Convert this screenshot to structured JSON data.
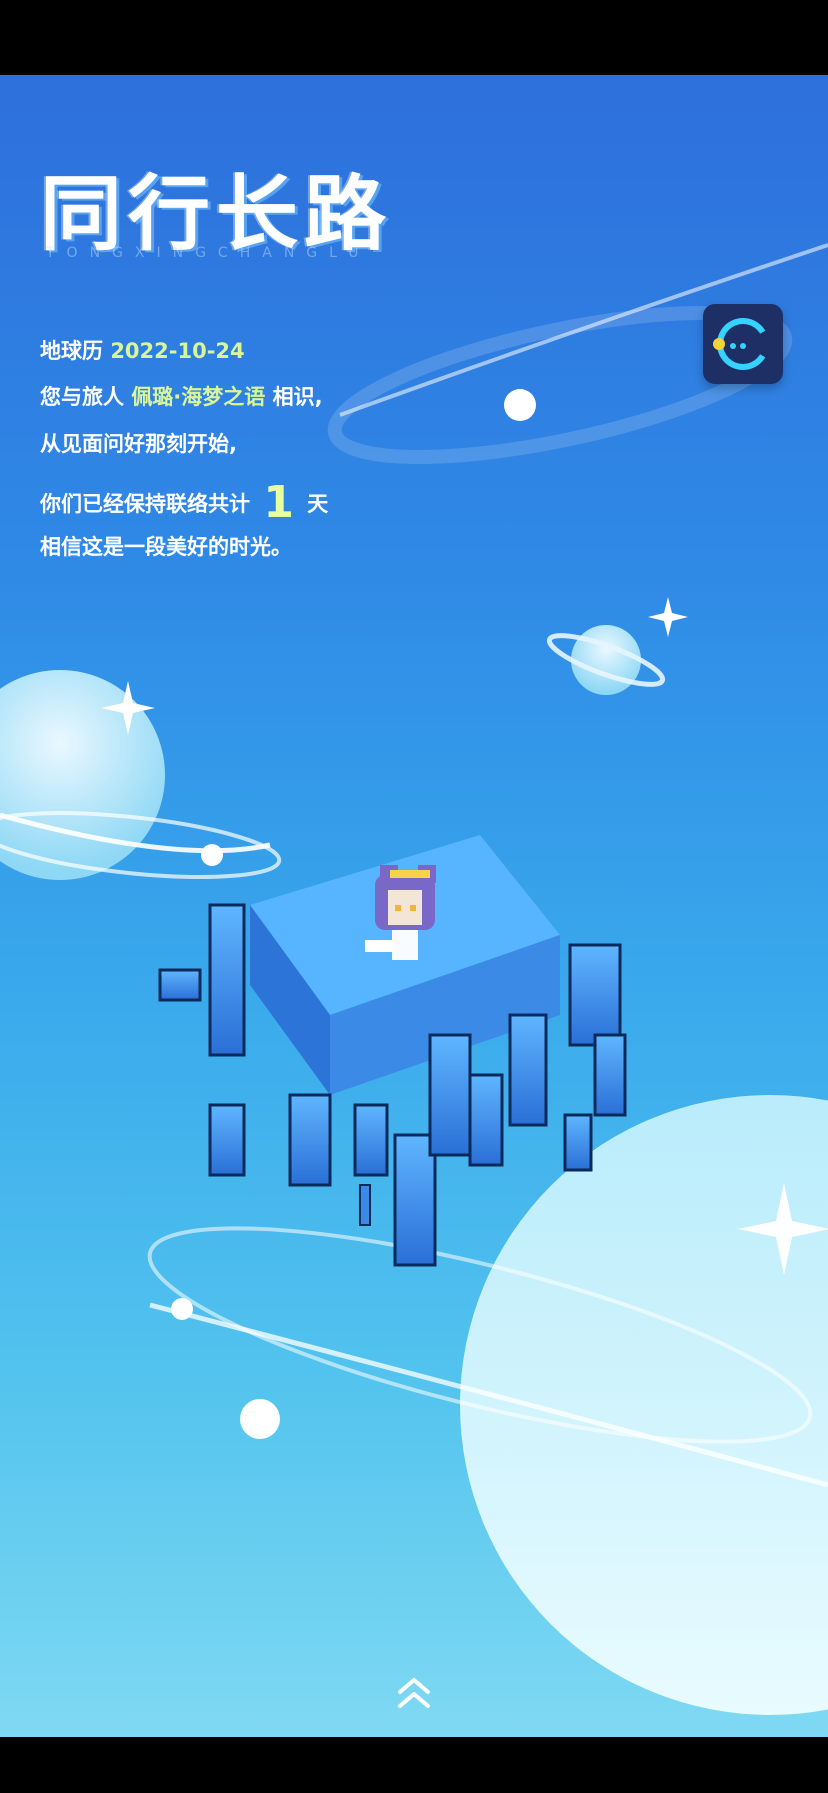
{
  "title": "同行长路",
  "subtitle": "TONGXINGCHANGLU",
  "intro": {
    "date_prefix": "地球历",
    "date": "2022-10-24",
    "line2_prefix": "您与旅人",
    "traveler_name": "佩璐·海梦之语",
    "line2_suffix": "相识,",
    "line3": "从见面问好那刻开始,",
    "line4_prefix": "你们已经保持联络共计",
    "days": "1",
    "line4_suffix": "天",
    "line5": "相信这是一段美好的时光。"
  },
  "colors": {
    "highlight": "#d8f59a",
    "accent_icon": "#35d4ff"
  },
  "icons": {
    "app_icon": "pacman-chat-icon",
    "scroll": "double-chevron-up-icon"
  }
}
